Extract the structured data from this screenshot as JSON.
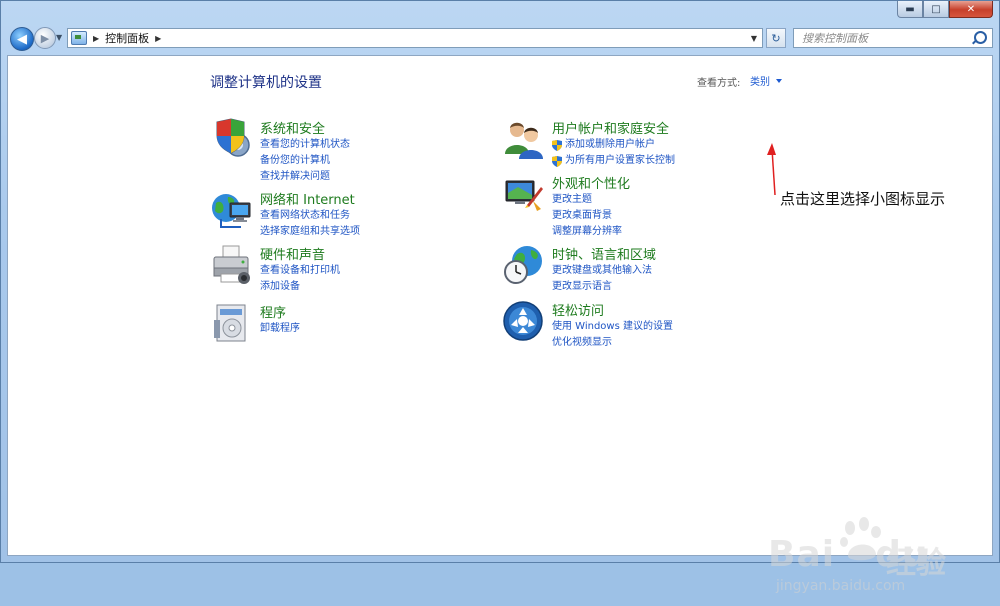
{
  "window": {
    "caption": {
      "minimize": "▬",
      "maximize": "□",
      "close": "✕"
    }
  },
  "navbar": {
    "back": "◀",
    "forward": "▶",
    "recent": "▼",
    "breadcrumb": [
      "控制面板"
    ],
    "address_dropdown": "▼",
    "refresh": "↻",
    "search": {
      "placeholder": "搜索控制面板"
    }
  },
  "content": {
    "title": "调整计算机的设置",
    "view_by": {
      "label": "查看方式:",
      "value": "类别"
    },
    "categories": [
      {
        "id": "system-security",
        "title": "系统和安全",
        "icon": "shield-computer-icon",
        "links": [
          "查看您的计算机状态",
          "备份您的计算机",
          "查找并解决问题"
        ]
      },
      {
        "id": "network-internet",
        "title": "网络和 Internet",
        "icon": "network-globe-icon",
        "links": [
          "查看网络状态和任务",
          "选择家庭组和共享选项"
        ]
      },
      {
        "id": "hardware-sound",
        "title": "硬件和声音",
        "icon": "printer-icon",
        "links": [
          "查看设备和打印机",
          "添加设备"
        ]
      },
      {
        "id": "programs",
        "title": "程序",
        "icon": "programs-icon",
        "links": [
          "卸载程序"
        ]
      },
      {
        "id": "user-accounts",
        "title": "用户帐户和家庭安全",
        "icon": "users-icon",
        "links": [
          "添加或删除用户帐户",
          "为所有用户设置家长控制"
        ]
      },
      {
        "id": "appearance",
        "title": "外观和个性化",
        "icon": "appearance-icon",
        "links": [
          "更改主题",
          "更改桌面背景",
          "调整屏幕分辨率"
        ]
      },
      {
        "id": "clock-language",
        "title": "时钟、语言和区域",
        "icon": "clock-globe-icon",
        "links": [
          "更改键盘或其他输入法",
          "更改显示语言"
        ]
      },
      {
        "id": "ease-of-access",
        "title": "轻松访问",
        "icon": "ease-of-access-icon",
        "links": [
          "使用 Windows 建议的设置",
          "优化视频显示"
        ]
      }
    ]
  },
  "annotation": {
    "text": "点击这里选择小图标显示"
  },
  "watermark": {
    "brand": "Bai",
    "brand2": "du",
    "jingyan": "经验",
    "url": "jingyan.baidu.com"
  },
  "colors": {
    "category_title": "#1e7b1e",
    "link": "#1f55c4",
    "page_title": "#1e3287",
    "annotation_arrow": "#e02020"
  }
}
